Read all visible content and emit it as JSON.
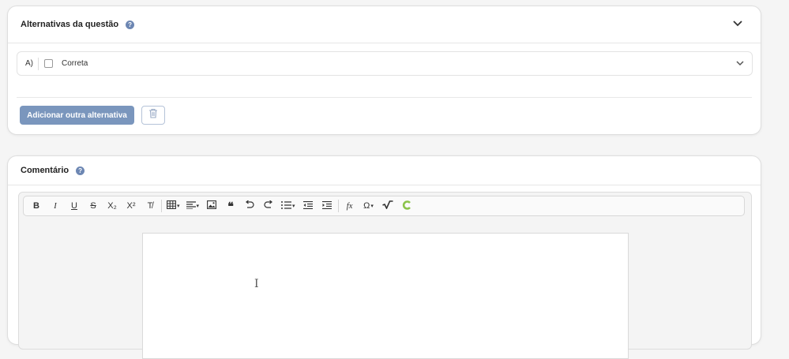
{
  "alternatives_card": {
    "title": "Alternativas da questão",
    "help": "?",
    "alternatives": [
      {
        "letter": "A)",
        "label": "Correta",
        "checked": false
      }
    ],
    "add_button": "Adicionar outra alternativa",
    "delete_icon": "trash-icon"
  },
  "comment_card": {
    "title": "Comentário",
    "help": "?",
    "toolbar": {
      "bold": "B",
      "italic": "I",
      "underline": "U",
      "strikethrough": "S",
      "subscript": "X₂",
      "superscript": "X²",
      "clear_format": "T̸",
      "fx": "fx",
      "omega": "Ω"
    }
  },
  "colors": {
    "accent": "#7a96bd",
    "help_icon": "#6d87b3",
    "plugin_logo": "#8bc34a"
  }
}
